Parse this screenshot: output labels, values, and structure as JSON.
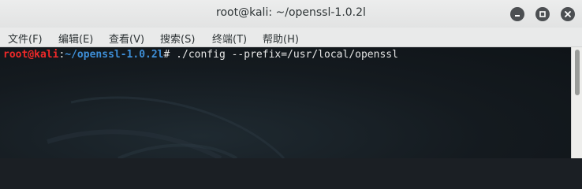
{
  "window": {
    "title": "root@kali: ~/openssl-1.0.2l"
  },
  "menu": {
    "items": [
      "文件(F)",
      "编辑(E)",
      "查看(V)",
      "搜索(S)",
      "终端(T)",
      "帮助(H)"
    ]
  },
  "terminal": {
    "prompt_user": "root@kali",
    "prompt_sep": ":",
    "prompt_path": "~/openssl-1.0.2l",
    "prompt_symbol": "#",
    "command": " ./config --prefix=/usr/local/openssl"
  },
  "icons": {
    "minimize": "minimize-icon",
    "maximize": "maximize-icon",
    "close": "close-icon"
  },
  "colors": {
    "prompt_user": "#ef2929",
    "prompt_path": "#3e8fd8",
    "terminal_bg": "#141a1f"
  }
}
